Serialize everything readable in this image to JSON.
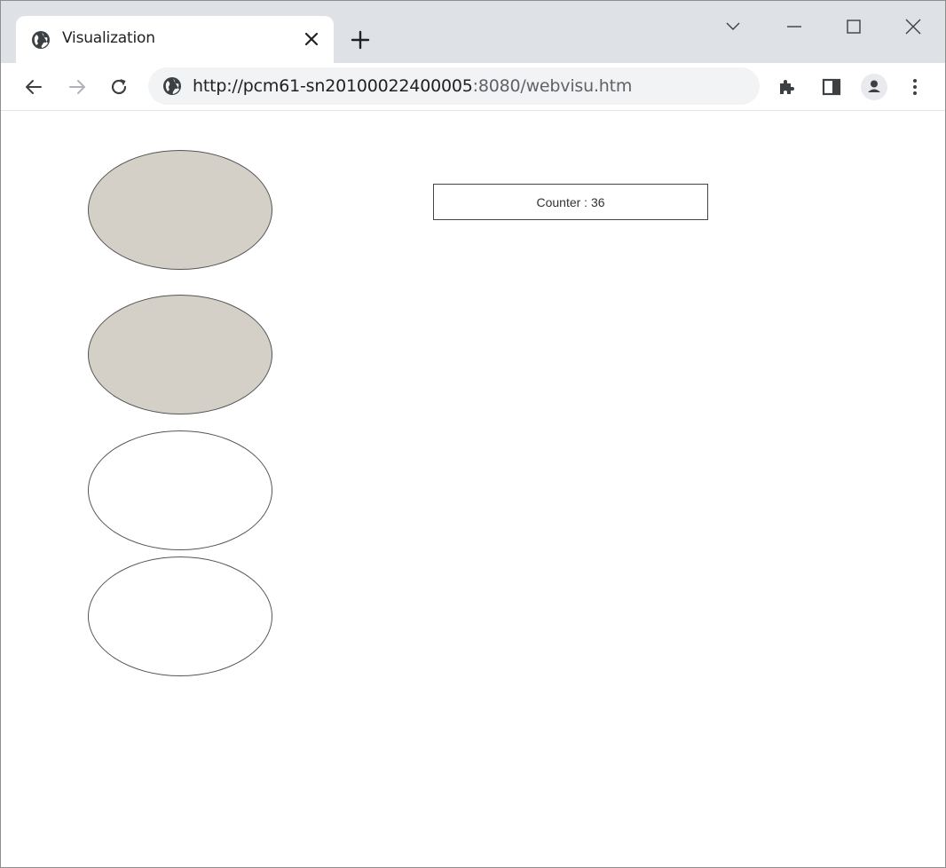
{
  "browser": {
    "tab_title": "Visualization",
    "url_host": "http://pcm61-sn20100022400005",
    "url_rest": ":8080/webvisu.htm",
    "icons": {
      "favicon": "globe-icon",
      "tab_close": "close-icon",
      "new_tab": "plus-icon",
      "tab_search": "chevron-down-icon",
      "minimize": "minimize-icon",
      "maximize": "maximize-icon",
      "close_window": "close-icon",
      "back": "back-arrow-icon",
      "forward": "forward-arrow-icon",
      "reload": "reload-icon",
      "site_info": "globe-icon",
      "extensions": "puzzle-icon",
      "side_panel": "side-panel-icon",
      "profile": "profile-icon",
      "menu": "kebab-menu-icon"
    }
  },
  "visu": {
    "lamps": [
      {
        "state": "on",
        "fill": "#d4d0c8"
      },
      {
        "state": "on",
        "fill": "#d4d0c8"
      },
      {
        "state": "off",
        "fill": "#ffffff"
      },
      {
        "state": "off",
        "fill": "#ffffff"
      }
    ],
    "counter_text": "Counter : 36"
  }
}
